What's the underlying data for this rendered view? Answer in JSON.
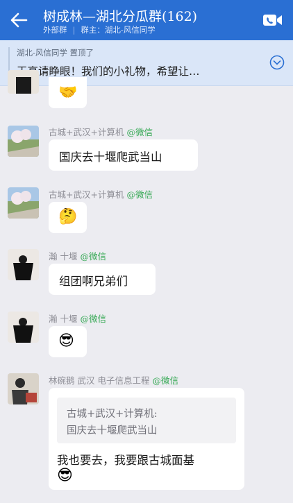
{
  "header": {
    "title": "树成林—湖北分瓜群(162)",
    "subtitle_left": "外部群",
    "subtitle_sep": "|",
    "subtitle_right": "群主：湖北-风信同学",
    "back_icon": "arrow-left-icon",
    "video_icon": "video-call-icon"
  },
  "pinned": {
    "meta": "湖北-风信同学  置顶了",
    "text": "天亮请睁眼！我们的小礼物，希望让…",
    "toggle_icon": "chevron-down-icon"
  },
  "messages": [
    {
      "emoji": "🤝"
    },
    {
      "sender": "古城+武汉+计算机",
      "tag": "@微信",
      "text": "国庆去十堰爬武当山"
    },
    {
      "sender": "古城+武汉+计算机",
      "tag": "@微信",
      "emoji": "🤔"
    },
    {
      "sender": "瀚 十堰",
      "tag": "@微信",
      "text": "组团啊兄弟们"
    },
    {
      "sender": "瀚 十堰",
      "tag": "@微信",
      "emoji": "😎"
    },
    {
      "sender": "林碗鹅 武汉 电子信息工程",
      "tag": "@微信",
      "quote_line1": "古城+武汉+计算机:",
      "quote_line2": "国庆去十堰爬武当山",
      "text": "我也要去，我要跟古城面基",
      "emoji": "😎"
    }
  ],
  "colors": {
    "header": "#2a6fd3",
    "pinned_bg": "#dae6f8",
    "chat_bg": "#ececf1",
    "wechat_tag": "#34a853"
  }
}
